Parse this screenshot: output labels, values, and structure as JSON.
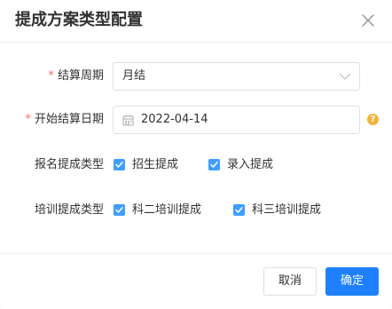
{
  "dialog": {
    "title": "提成方案类型配置"
  },
  "form": {
    "settlement_period": {
      "required_mark": "*",
      "label": "结算周期",
      "value": "月结"
    },
    "start_date": {
      "required_mark": "*",
      "label": "开始结算日期",
      "value": "2022-04-14",
      "help_text": "?"
    },
    "signup_commission": {
      "label": "报名提成类型",
      "options": [
        {
          "label": "招生提成",
          "checked": true
        },
        {
          "label": "录入提成",
          "checked": true
        }
      ]
    },
    "training_commission": {
      "label": "培训提成类型",
      "options": [
        {
          "label": "科二培训提成",
          "checked": true
        },
        {
          "label": "科三培训提成",
          "checked": true
        }
      ]
    }
  },
  "footer": {
    "cancel_label": "取消",
    "confirm_label": "确定"
  },
  "colors": {
    "primary": "#1e80ff",
    "checkbox": "#409eff",
    "required": "#f56c6c",
    "help": "#f0b43a"
  },
  "icons": {
    "close": "close-icon",
    "arrow": "chevron-down-icon",
    "calendar": "calendar-icon",
    "help": "question-circle-icon",
    "check": "check-icon"
  }
}
